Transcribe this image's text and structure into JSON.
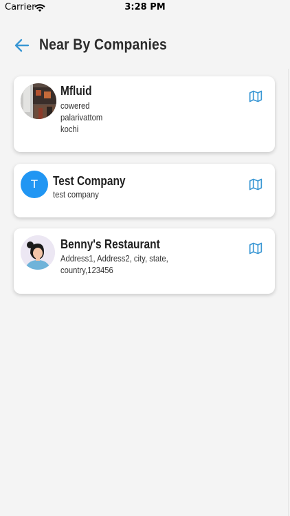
{
  "status_bar": {
    "carrier": "Carrier",
    "time": "3:28 PM"
  },
  "header": {
    "title": "Near By Companies"
  },
  "companies": [
    {
      "name": "Mfluid",
      "address_lines": [
        "cowered",
        "palarivattom",
        "kochi"
      ],
      "avatar": "photo"
    },
    {
      "name": "Test Company",
      "address_lines": [
        "test company"
      ],
      "avatar": "letter",
      "initial": "T"
    },
    {
      "name": "Benny's Restaurant",
      "address_lines": [
        "Address1, Address2, city, state,",
        "country,123456"
      ],
      "avatar": "illustration"
    }
  ],
  "icons": {
    "back": "arrow-left-icon",
    "map": "map-icon"
  },
  "colors": {
    "accent": "#3a97d4",
    "avatar_letter_bg": "#2196f3"
  }
}
